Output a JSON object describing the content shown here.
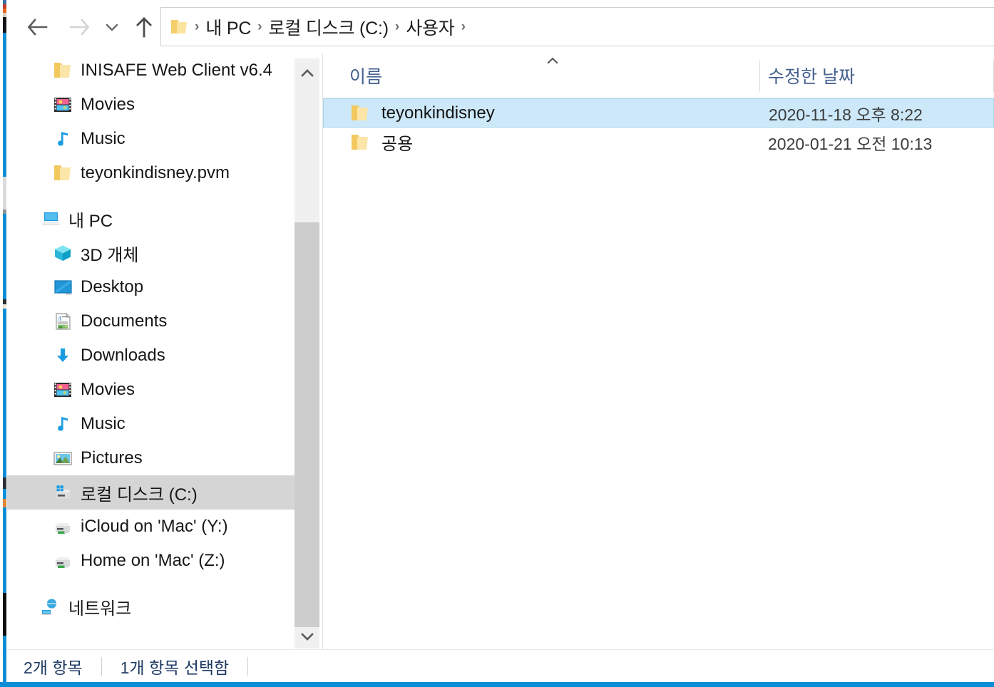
{
  "window": {
    "accent_color": "#0c8ed6",
    "selection_color": "#cce8f9",
    "header_text_color": "#46618e"
  },
  "toolbar": {
    "back_label": "뒤로",
    "forward_label": "앞으로",
    "recent_label": "최근 위치",
    "up_label": "위로"
  },
  "address_bar": {
    "crumbs": [
      {
        "label": "내 PC"
      },
      {
        "label": "로컬 디스크 (C:)"
      },
      {
        "label": "사용자"
      }
    ],
    "separator": "›"
  },
  "sidebar": {
    "items": [
      {
        "label": "INISAFE Web Client v6.4",
        "icon": "folder-icon",
        "level": "child",
        "selected": false
      },
      {
        "label": "Movies",
        "icon": "movies-icon",
        "level": "child",
        "selected": false
      },
      {
        "label": "Music",
        "icon": "music-icon",
        "level": "child",
        "selected": false
      },
      {
        "label": "teyonkindisney.pvm",
        "icon": "folder-icon",
        "level": "child",
        "selected": false
      },
      {
        "label": "내 PC",
        "icon": "this-pc-icon",
        "level": "root",
        "selected": false
      },
      {
        "label": "3D 개체",
        "icon": "3d-objects-icon",
        "level": "child",
        "selected": false
      },
      {
        "label": "Desktop",
        "icon": "desktop-icon",
        "level": "child",
        "selected": false
      },
      {
        "label": "Documents",
        "icon": "documents-icon",
        "level": "child",
        "selected": false
      },
      {
        "label": "Downloads",
        "icon": "downloads-icon",
        "level": "child",
        "selected": false
      },
      {
        "label": "Movies",
        "icon": "movies-icon",
        "level": "child",
        "selected": false
      },
      {
        "label": "Music",
        "icon": "music-icon",
        "level": "child",
        "selected": false
      },
      {
        "label": "Pictures",
        "icon": "pictures-icon",
        "level": "child",
        "selected": false
      },
      {
        "label": "로컬 디스크 (C:)",
        "icon": "local-disk-icon",
        "level": "child",
        "selected": true
      },
      {
        "label": "iCloud on 'Mac' (Y:)",
        "icon": "network-drive-icon",
        "level": "child",
        "selected": false
      },
      {
        "label": "Home on 'Mac' (Z:)",
        "icon": "network-drive-icon",
        "level": "child",
        "selected": false
      },
      {
        "label": "네트워크",
        "icon": "network-icon",
        "level": "root",
        "selected": false
      }
    ]
  },
  "file_list": {
    "columns": [
      {
        "label": "이름",
        "sorted": "asc"
      },
      {
        "label": "수정한 날짜",
        "sorted": "none"
      }
    ],
    "rows": [
      {
        "name": "teyonkindisney",
        "date": "2020-11-18 오후 8:22",
        "icon": "folder-icon",
        "selected": true
      },
      {
        "name": "공용",
        "date": "2020-01-21 오전 10:13",
        "icon": "folder-icon",
        "selected": false
      }
    ]
  },
  "status_bar": {
    "item_count": "2개 항목",
    "selection": "1개 항목 선택함"
  }
}
